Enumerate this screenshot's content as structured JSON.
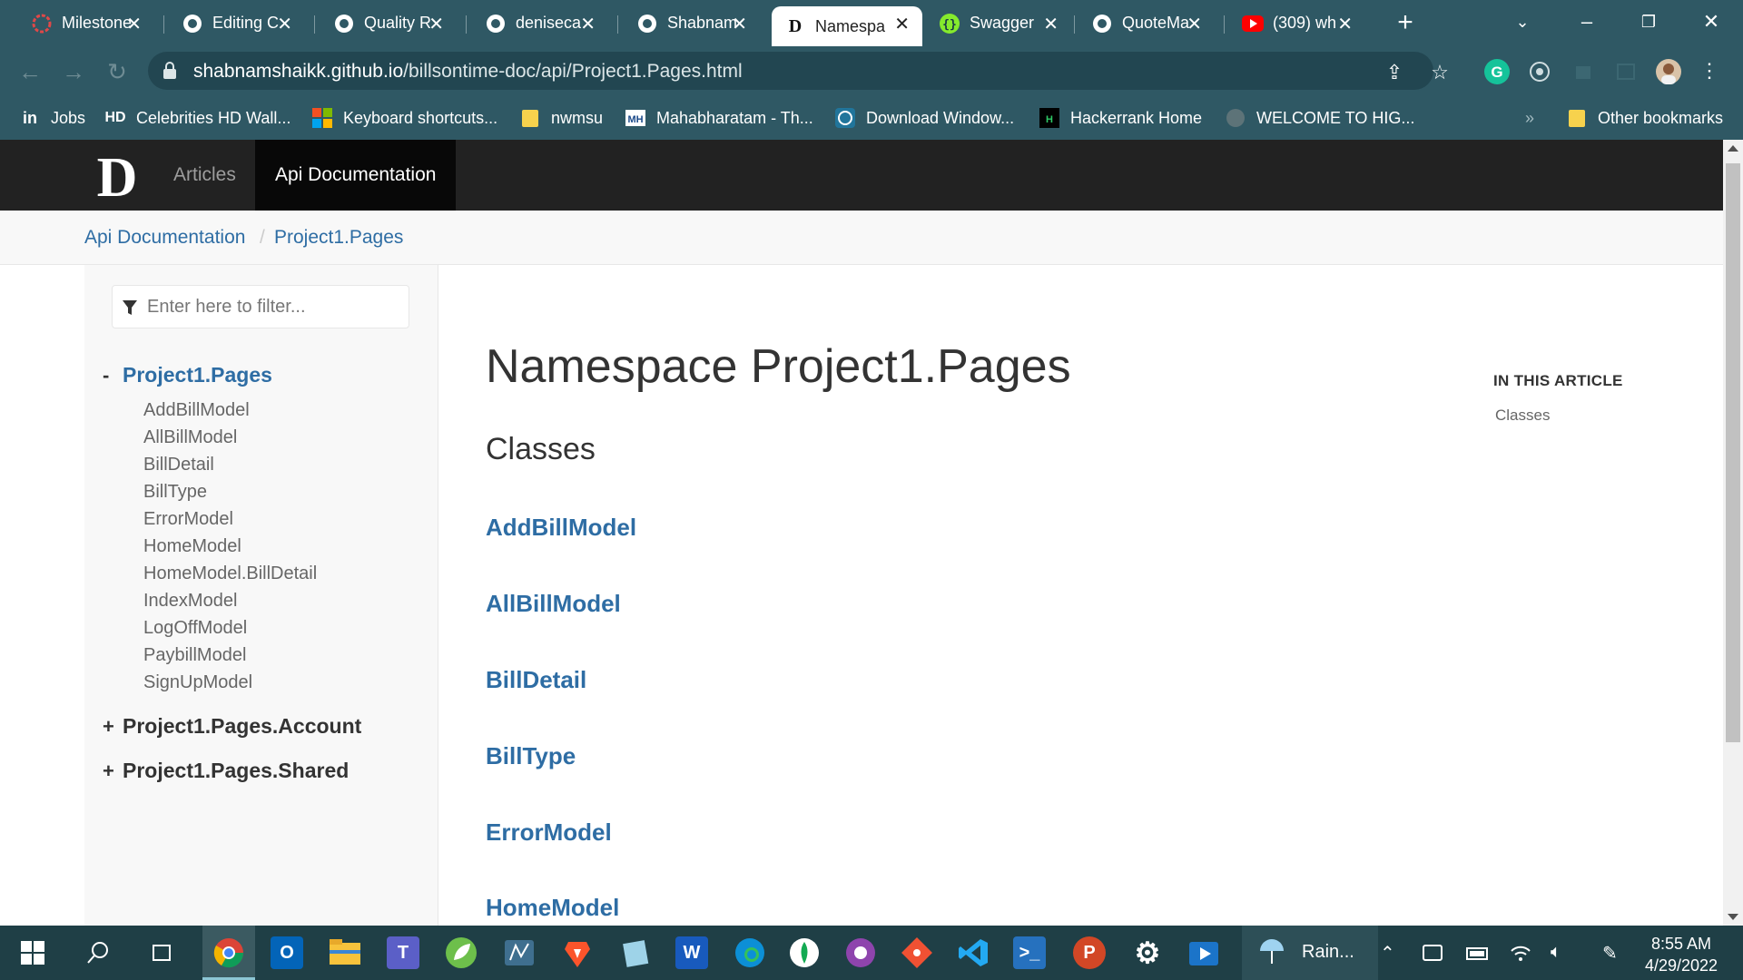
{
  "browser": {
    "tabs": [
      {
        "title": "Milestone",
        "icon": "circle-icon"
      },
      {
        "title": "Editing C",
        "icon": "github-icon"
      },
      {
        "title": "Quality R",
        "icon": "github-icon"
      },
      {
        "title": "deniseca",
        "icon": "github-icon"
      },
      {
        "title": "Shabnam",
        "icon": "github-icon"
      },
      {
        "title": "Namespa",
        "icon": "docfx-icon",
        "active": true
      },
      {
        "title": "Swagger",
        "icon": "swagger-icon"
      },
      {
        "title": "QuoteMa",
        "icon": "github-icon"
      },
      {
        "title": "(309) wh",
        "icon": "youtube-icon"
      }
    ],
    "url_host": "shabnamshaikk.github.io",
    "url_path": "/billsontime-doc/api/Project1.Pages.html",
    "bookmarks": [
      {
        "label": "Jobs",
        "icon": "linkedin-icon"
      },
      {
        "label": "Celebrities HD Wall...",
        "icon": "hd-icon"
      },
      {
        "label": "Keyboard shortcuts...",
        "icon": "microsoft-icon"
      },
      {
        "label": "nwmsu",
        "icon": "folder-icon"
      },
      {
        "label": "Mahabharatam - Th...",
        "icon": "mahabharatam-icon"
      },
      {
        "label": "Download Window...",
        "icon": "wordpress-icon"
      },
      {
        "label": "Hackerrank Home",
        "icon": "hackerrank-icon"
      },
      {
        "label": "WELCOME TO HIG...",
        "icon": "globe-icon"
      }
    ],
    "other_bookmarks": "Other bookmarks",
    "bookmarks_overflow": "»"
  },
  "site": {
    "logo": "D",
    "nav": [
      {
        "label": "Articles",
        "active": false
      },
      {
        "label": "Api Documentation",
        "active": true
      }
    ],
    "breadcrumb": [
      "Api Documentation",
      "Project1.Pages"
    ],
    "breadcrumb_sep": "/"
  },
  "sidebar": {
    "filter_placeholder": "Enter here to filter...",
    "namespaces": [
      {
        "sign": "-",
        "label": "Project1.Pages",
        "expanded": true,
        "classes": [
          "AddBillModel",
          "AllBillModel",
          "BillDetail",
          "BillType",
          "ErrorModel",
          "HomeModel",
          "HomeModel.BillDetail",
          "IndexModel",
          "LogOffModel",
          "PaybillModel",
          "SignUpModel"
        ]
      },
      {
        "sign": "+",
        "label": "Project1.Pages.Account",
        "expanded": false,
        "classes": []
      },
      {
        "sign": "+",
        "label": "Project1.Pages.Shared",
        "expanded": false,
        "classes": []
      }
    ]
  },
  "article": {
    "title": "Namespace Project1.Pages",
    "section": "Classes",
    "classes": [
      "AddBillModel",
      "AllBillModel",
      "BillDetail",
      "BillType",
      "ErrorModel",
      "HomeModel"
    ]
  },
  "affix": {
    "title": "IN THIS ARTICLE",
    "links": [
      "Classes"
    ]
  },
  "taskbar": {
    "weather": "Rain...",
    "time": "8:55 AM",
    "date": "4/29/2022"
  },
  "colors": {
    "browser_frame": "#2f5864",
    "link_blue": "#2e6da4",
    "header_bg": "#222222",
    "taskbar_bg": "#1f3f46"
  }
}
